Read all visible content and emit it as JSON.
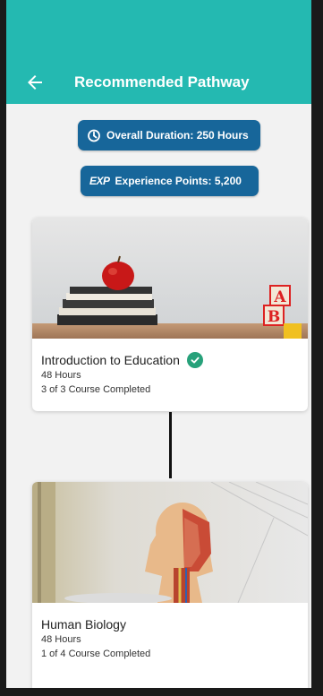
{
  "header": {
    "title": "Recommended Pathway",
    "back_icon": "arrow-left-icon",
    "background": "#24b9b1"
  },
  "chips": {
    "duration": {
      "icon": "timer-icon",
      "label": "Overall Duration: 250 Hours"
    },
    "experience": {
      "badge": "EXP",
      "label": "Experience Points: 5,200"
    },
    "color": "#17669a"
  },
  "courses": [
    {
      "name": "Introduction to Education",
      "hours": "48 Hours",
      "progress": "3 of 3 Course Completed",
      "completed": true,
      "image": "apple-on-books-with-abc-blocks"
    },
    {
      "name": "Human Biology",
      "hours": "48 Hours",
      "progress": "1 of 4 Course Completed",
      "completed": false,
      "image": "anatomy-model"
    }
  ]
}
